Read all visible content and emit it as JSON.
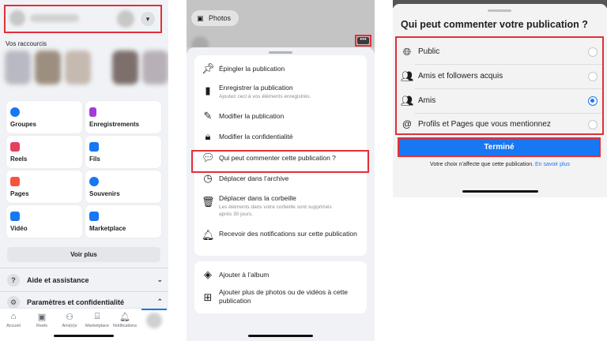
{
  "panel1": {
    "shortcuts_title": "Vos raccourcis",
    "tiles": [
      {
        "label": "Groupes",
        "icon": "groups-icon",
        "color": "#1877f2"
      },
      {
        "label": "Enregistrements",
        "icon": "bookmark-icon",
        "color": "#a33ad8"
      },
      {
        "label": "Reels",
        "icon": "reels-icon",
        "color": "#e4405f"
      },
      {
        "label": "Fils",
        "icon": "feeds-icon",
        "color": "#1877f2"
      },
      {
        "label": "Pages",
        "icon": "flag-icon",
        "color": "#f5533d"
      },
      {
        "label": "Souvenirs",
        "icon": "memories-icon",
        "color": "#1877f2"
      },
      {
        "label": "Vidéo",
        "icon": "video-icon",
        "color": "#1877f2"
      },
      {
        "label": "Marketplace",
        "icon": "marketplace-icon",
        "color": "#1877f2"
      }
    ],
    "see_more": "Voir plus",
    "help": "Aide et assistance",
    "settings": "Paramètres et confidentialité",
    "tabs": [
      "Accueil",
      "Reels",
      "Ami(e)s",
      "Marketplace",
      "Notifications"
    ]
  },
  "panel2": {
    "photos_label": "Photos",
    "menu_main": [
      {
        "label": "Épingler la publication",
        "icon": "pin-icon",
        "sub": ""
      },
      {
        "label": "Enregistrer la publication",
        "icon": "bookmark-icon",
        "sub": "Ajoutez ceci à vos éléments enregistrés."
      },
      {
        "label": "Modifier la publication",
        "icon": "pencil-icon",
        "sub": ""
      },
      {
        "label": "Modifier la confidentialité",
        "icon": "lock-icon",
        "sub": ""
      },
      {
        "label": "Qui peut commenter cette publication ?",
        "icon": "comment-shield-icon",
        "sub": ""
      },
      {
        "label": "Déplacer dans l’archive",
        "icon": "archive-icon",
        "sub": ""
      },
      {
        "label": "Déplacer dans la corbeille",
        "icon": "trash-icon",
        "sub": "Les éléments dans votre corbeille sont supprimés après 30 jours."
      },
      {
        "label": "Recevoir des notifications sur cette publication",
        "icon": "bell-icon",
        "sub": ""
      }
    ],
    "menu_album": [
      {
        "label": "Ajouter à l’album",
        "icon": "album-icon"
      },
      {
        "label": "Ajouter plus de photos ou de vidéos à cette publication",
        "icon": "add-media-icon"
      }
    ]
  },
  "panel3": {
    "title": "Qui peut commenter votre publication ?",
    "options": [
      {
        "label": "Public",
        "icon": "globe-icon",
        "selected": false
      },
      {
        "label": "Amis et followers acquis",
        "icon": "friends-icon",
        "selected": false
      },
      {
        "label": "Amis",
        "icon": "friends-icon",
        "selected": true
      },
      {
        "label": "Profils et Pages que vous mentionnez",
        "icon": "at-icon",
        "selected": false
      }
    ],
    "done": "Terminé",
    "note_text": "Votre choix n’affecte que cette publication.",
    "note_link": "En savoir plus"
  }
}
